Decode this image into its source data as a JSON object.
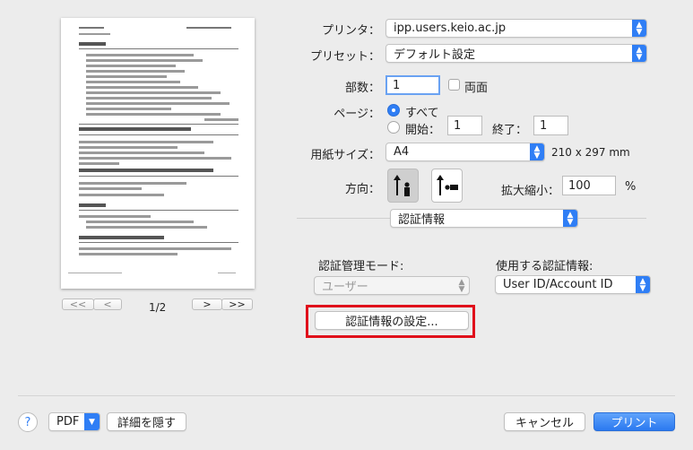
{
  "preview": {
    "page_indicator": "1/2",
    "first_btn": "<<",
    "prev_btn": "<",
    "next_btn": ">",
    "last_btn": ">>"
  },
  "printer": {
    "label": "プリンタ：",
    "value": "ipp.users.keio.ac.jp"
  },
  "preset": {
    "label": "プリセット：",
    "value": "デフォルト設定"
  },
  "copies": {
    "label": "部数：",
    "value": "1",
    "duplex_label": "両面"
  },
  "pages": {
    "label": "ページ：",
    "all_label": "すべて",
    "from_label": "開始：",
    "from_value": "1",
    "to_label": "終了：",
    "to_value": "1"
  },
  "paper": {
    "label": "用紙サイズ：",
    "value": "A4",
    "dimensions": "210 x 297 mm"
  },
  "orientation": {
    "label": "方向："
  },
  "scale": {
    "label": "拡大縮小：",
    "value": "100",
    "unit": "%"
  },
  "section": {
    "value": "認証情報"
  },
  "auth": {
    "mode_label": "認証管理モード:",
    "mode_value": "ユーザー",
    "info_label": "使用する認証情報:",
    "info_value": "User ID/Account ID",
    "settings_button": "認証情報の設定..."
  },
  "footer": {
    "help": "?",
    "pdf": "PDF",
    "hide_details": "詳細を隠す",
    "cancel": "キャンセル",
    "print": "プリント"
  },
  "colors": {
    "accent": "#2f7ef5",
    "highlight_border": "#e0101b"
  }
}
